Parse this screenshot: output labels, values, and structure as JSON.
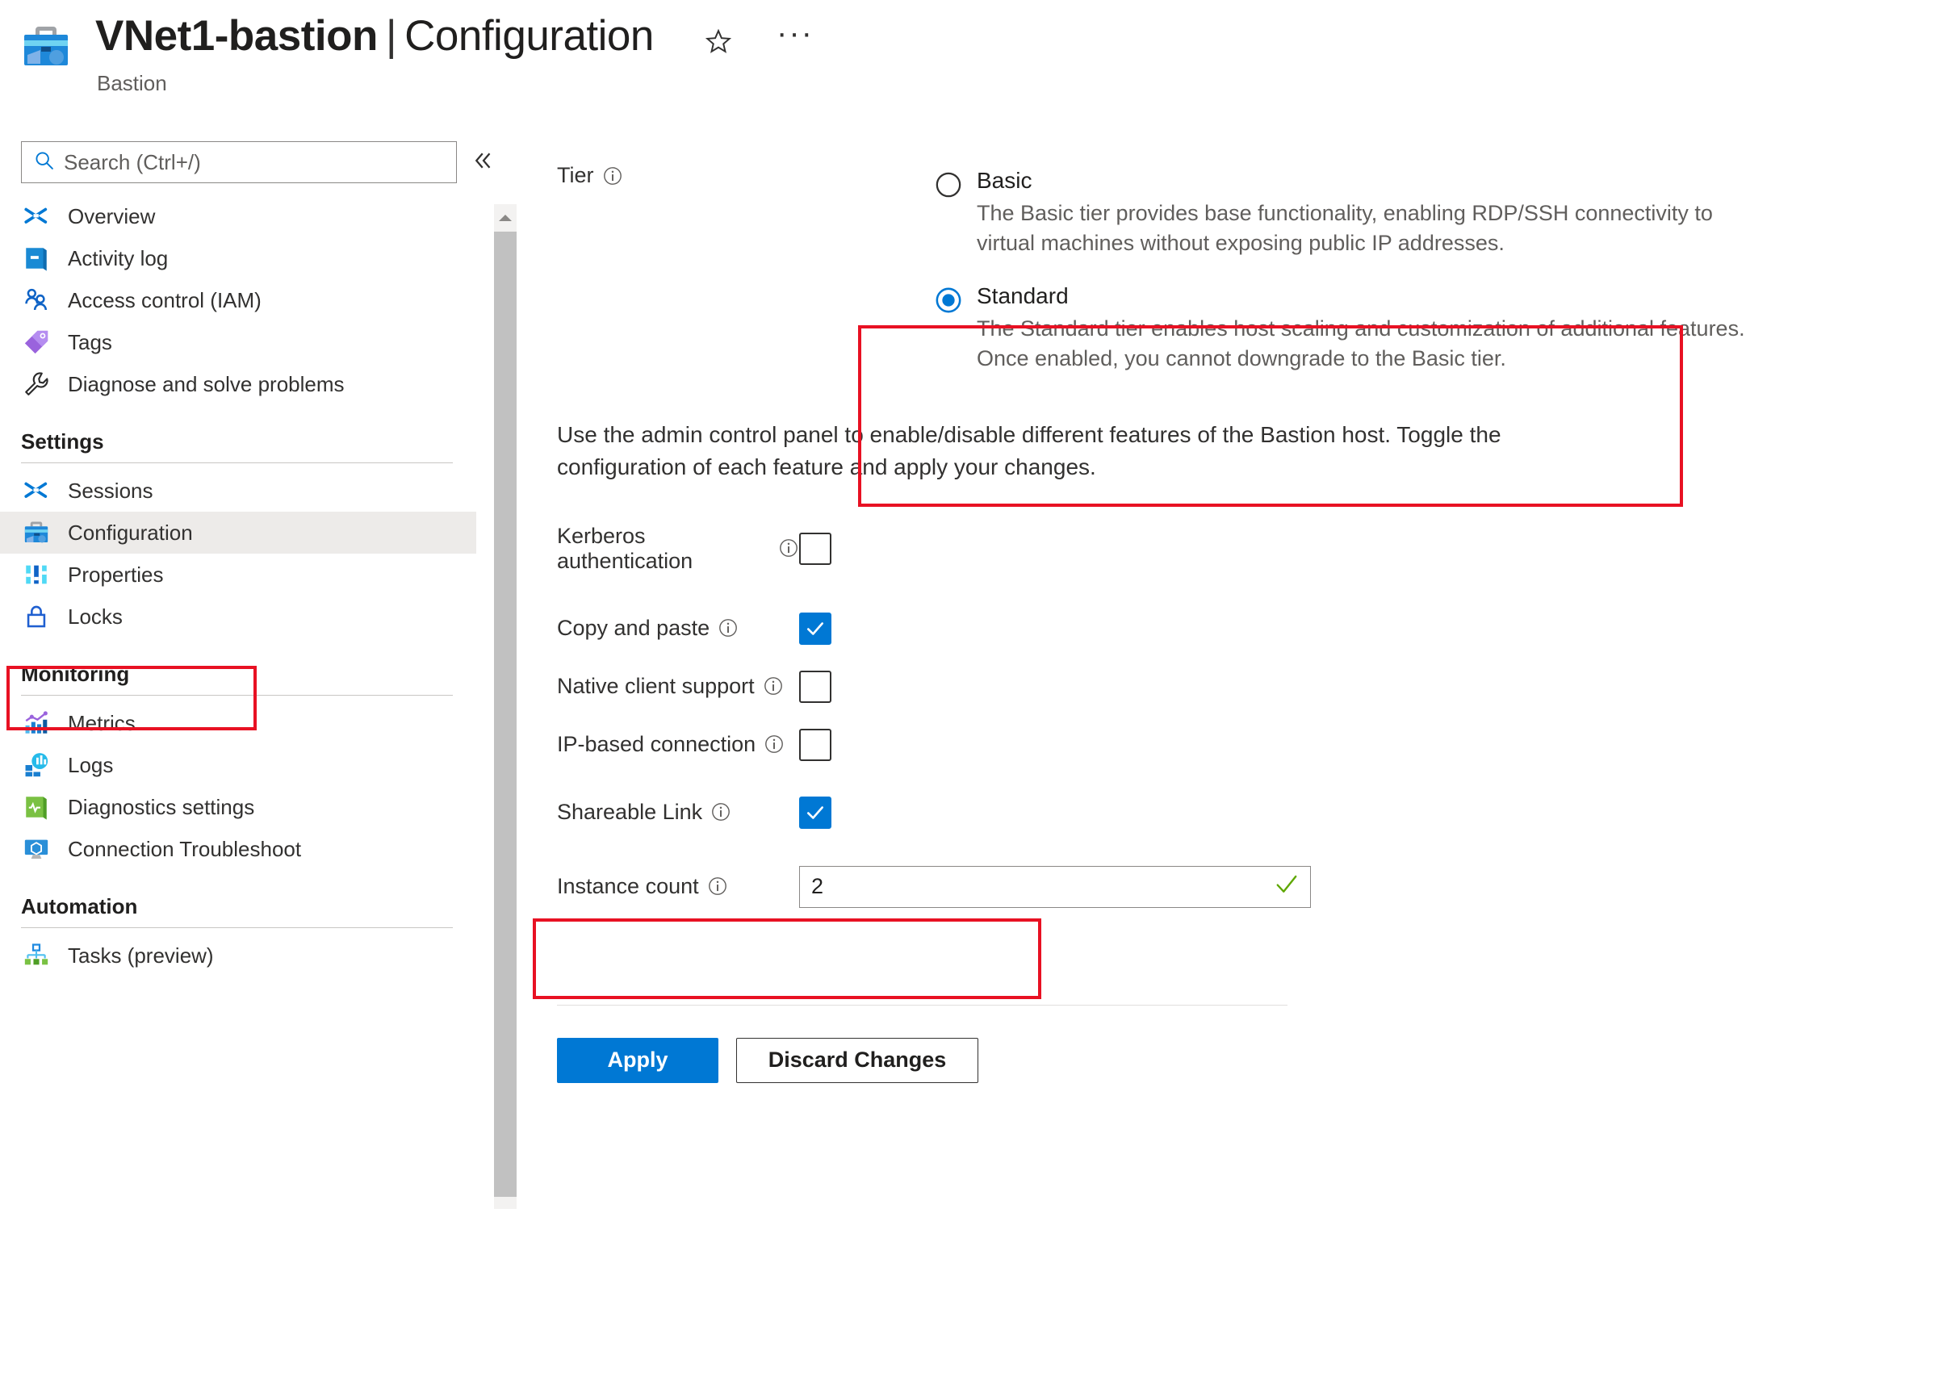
{
  "header": {
    "icon": "bastion-icon",
    "resource_name": "VNet1-bastion",
    "separator": "|",
    "section": "Configuration",
    "subtitle": "Bastion",
    "favorite_icon": "star-icon",
    "more_icon": "ellipsis-icon"
  },
  "sidebar": {
    "search": {
      "placeholder": "Search (Ctrl+/)",
      "value": "",
      "icon": "search-icon"
    },
    "collapse_icon": "double-chevron-left-icon",
    "items": [
      {
        "label": "Overview",
        "icon": "overview-icon",
        "selected": false
      },
      {
        "label": "Activity log",
        "icon": "activity-log-icon",
        "selected": false
      },
      {
        "label": "Access control (IAM)",
        "icon": "access-control-icon",
        "selected": false
      },
      {
        "label": "Tags",
        "icon": "tags-icon",
        "selected": false
      },
      {
        "label": "Diagnose and solve problems",
        "icon": "wrench-icon",
        "selected": false
      }
    ],
    "groups": [
      {
        "title": "Settings",
        "items": [
          {
            "label": "Sessions",
            "icon": "sessions-icon",
            "selected": false
          },
          {
            "label": "Configuration",
            "icon": "configuration-icon",
            "selected": true
          },
          {
            "label": "Properties",
            "icon": "properties-icon",
            "selected": false
          },
          {
            "label": "Locks",
            "icon": "lock-icon",
            "selected": false
          }
        ]
      },
      {
        "title": "Monitoring",
        "items": [
          {
            "label": "Metrics",
            "icon": "metrics-icon",
            "selected": false
          },
          {
            "label": "Logs",
            "icon": "logs-icon",
            "selected": false
          },
          {
            "label": "Diagnostics settings",
            "icon": "diagnostics-settings-icon",
            "selected": false
          },
          {
            "label": "Connection Troubleshoot",
            "icon": "connection-troubleshoot-icon",
            "selected": false
          }
        ]
      },
      {
        "title": "Automation",
        "items": [
          {
            "label": "Tasks (preview)",
            "icon": "tasks-icon",
            "selected": false
          }
        ]
      }
    ]
  },
  "main": {
    "tier": {
      "label": "Tier",
      "info_icon": "info-icon",
      "options": [
        {
          "name": "Basic",
          "description": "The Basic tier provides base functionality, enabling RDP/SSH connectivity to virtual machines without exposing public IP addresses.",
          "selected": false
        },
        {
          "name": "Standard",
          "description": "The Standard tier enables host scaling and customization of additional features. Once enabled, you cannot downgrade to the Basic tier.",
          "selected": true
        }
      ]
    },
    "intro_text": "Use the admin control panel to enable/disable different features of the Bastion host. Toggle the configuration of each feature and apply your changes.",
    "features": [
      {
        "label": "Kerberos authentication",
        "checked": false,
        "info_icon": "info-icon"
      },
      {
        "label": "Copy and paste",
        "checked": true,
        "info_icon": "info-icon"
      },
      {
        "label": "Native client support",
        "checked": false,
        "info_icon": "info-icon"
      },
      {
        "label": "IP-based connection",
        "checked": false,
        "info_icon": "info-icon"
      },
      {
        "label": "Shareable Link",
        "checked": true,
        "info_icon": "info-icon"
      }
    ],
    "instance_count": {
      "label": "Instance count",
      "info_icon": "info-icon",
      "value": "2",
      "validation_icon": "green-check-icon"
    },
    "buttons": {
      "apply": "Apply",
      "discard": "Discard Changes"
    }
  },
  "colors": {
    "accent": "#0078d4",
    "annotation": "#e81123",
    "validation_green": "#5ea700",
    "selected_row": "#edebe9"
  }
}
